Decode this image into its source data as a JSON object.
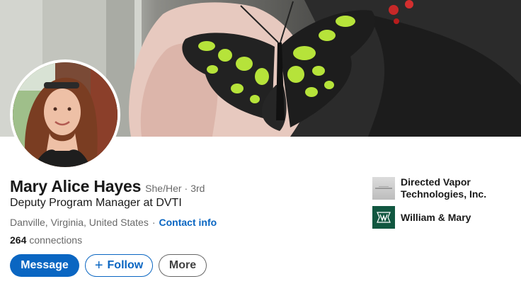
{
  "profile": {
    "name": "Mary Alice Hayes",
    "pronouns": "She/Her",
    "separator": "·",
    "degree": "3rd",
    "headline": "Deputy Program Manager at DVTI",
    "location": "Danville, Virginia, United States",
    "contact_label": "Contact info",
    "connections_count": "264",
    "connections_label": "connections"
  },
  "actions": {
    "message_label": "Message",
    "follow_icon": "+",
    "follow_label": "Follow",
    "more_label": "More"
  },
  "organizations": [
    {
      "name": "Directed Vapor Technologies, Inc.",
      "icon": "company-logo-icon"
    },
    {
      "name": "William & Mary",
      "icon": "school-logo-icon"
    }
  ],
  "images": {
    "cover": "butterfly-cover-photo",
    "avatar": "profile-photo"
  },
  "colors": {
    "brand_blue": "#0a66c2",
    "wm_green": "#115740",
    "butterfly_green": "#b6e33a"
  }
}
